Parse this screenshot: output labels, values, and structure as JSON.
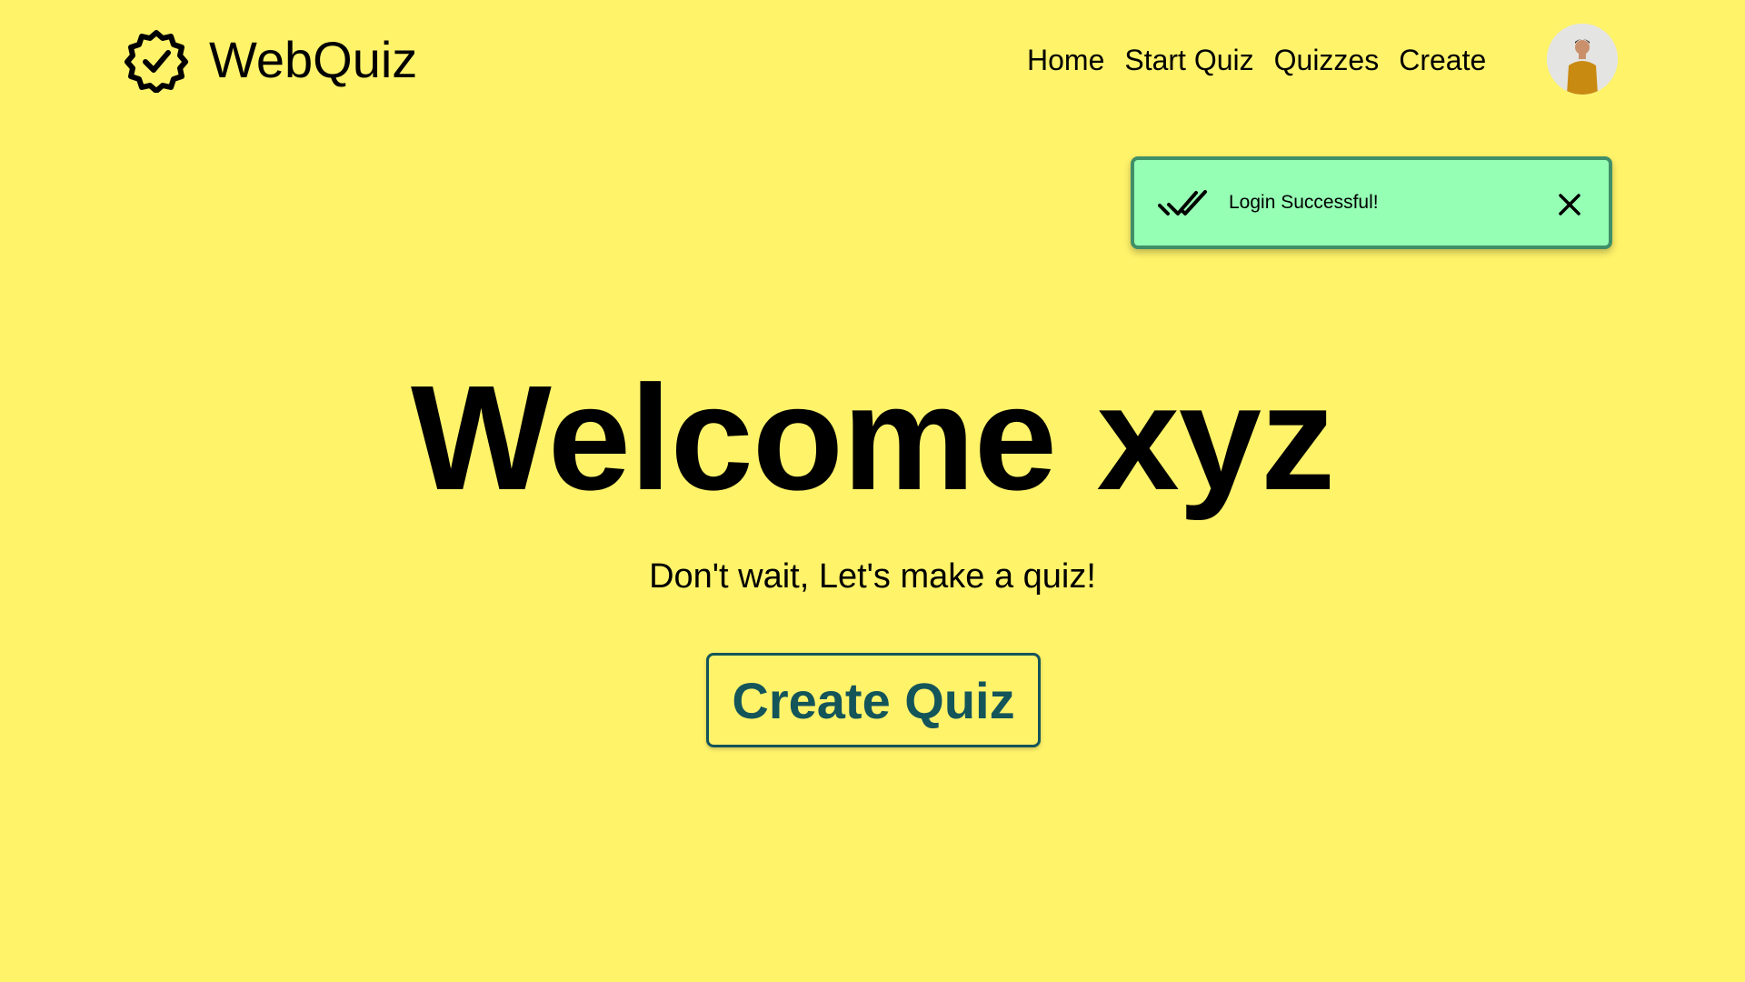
{
  "header": {
    "brand_name": "WebQuiz",
    "brand_icon": "verified-badge-icon",
    "nav": [
      {
        "label": "Home"
      },
      {
        "label": "Start Quiz"
      },
      {
        "label": "Quizzes"
      },
      {
        "label": "Create"
      }
    ],
    "avatar_icon": "user-avatar"
  },
  "toast": {
    "icon": "double-check-icon",
    "message": "Login Successful!",
    "close_icon": "close-icon",
    "background": "#95ffb4",
    "border": "#3f8f68"
  },
  "hero": {
    "title": "Welcome xyz",
    "subtitle": "Don't wait, Let's make a quiz!",
    "cta_label": "Create Quiz"
  },
  "colors": {
    "page_background": "#fff36a",
    "accent": "#14555a"
  }
}
